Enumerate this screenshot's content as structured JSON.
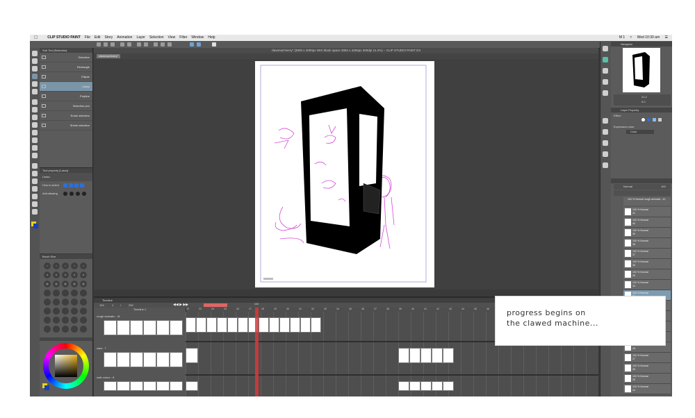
{
  "menubar": {
    "app": "CLIP STUDIO PAINT",
    "items": [
      "File",
      "Edit",
      "Story",
      "Animation",
      "Layer",
      "Selection",
      "View",
      "Filter",
      "Window",
      "Help"
    ],
    "status": "M 1",
    "clock": "Wed 10:30 am"
  },
  "window": {
    "title": "clawmachinery* (3000 x 4000px WHI blank space 3084 x 4284px 300dpi 21.2%) – CLIP STUDIO PAINT EX",
    "tab": "clawmachinery*"
  },
  "subtool": {
    "header": "Sub Tool [Selection]",
    "items": [
      {
        "label": "Selection"
      },
      {
        "label": "Rectangle"
      },
      {
        "label": "Ellipse"
      },
      {
        "label": "Lasso",
        "selected": true
      },
      {
        "label": "Polyline"
      },
      {
        "label": "Selection pen"
      },
      {
        "label": "Erase selection"
      },
      {
        "label": "Shrink selection"
      }
    ]
  },
  "toolprop": {
    "header": "Tool property [Lasso]",
    "tool_name": "Lasso",
    "rows": [
      {
        "label": "How to select"
      },
      {
        "label": "Anti-aliasing"
      }
    ]
  },
  "brush": {
    "header": "Brush Size"
  },
  "timeline": {
    "header": "Timeline",
    "name": "Timeline 1",
    "controls": [
      "102",
      "1",
      "/",
      "232"
    ],
    "frame_numbers": [
      "22",
      "23",
      "24",
      "25",
      "26",
      "27",
      "28",
      "29",
      "30",
      "31",
      "32",
      "33",
      "34",
      "35",
      "36",
      "37",
      "38",
      "39",
      "40",
      "41",
      "42",
      "43",
      "44",
      "45",
      "46",
      "47",
      "48",
      "49",
      "50",
      "51",
      "52",
      "53",
      "54"
    ],
    "current_frame": "103",
    "tracks": [
      {
        "name": "rough animatic : 41"
      },
      {
        "name": "claw : 7"
      },
      {
        "name": "nath colour : 8"
      }
    ]
  },
  "navigator": {
    "header": "Navigator",
    "zoom": "21.2",
    "angle": "0.0"
  },
  "layerprop": {
    "header": "Layer Property",
    "effect": "Effect",
    "expression": "Expression color",
    "expression_value": "Color"
  },
  "layers": {
    "blend": "Normal",
    "opacity": "100",
    "folder": "100 % Normal rough animatic : 41",
    "items": [
      {
        "pct": "100 % Normal",
        "name": "41"
      },
      {
        "pct": "100 % Normal",
        "name": "40"
      },
      {
        "pct": "100 % Normal",
        "name": "39"
      },
      {
        "pct": "100 % Normal",
        "name": "38"
      },
      {
        "pct": "100 % Normal",
        "name": "37"
      },
      {
        "pct": "100 % Normal",
        "name": "36"
      },
      {
        "pct": "100 % Normal",
        "name": "35"
      },
      {
        "pct": "100 % Normal",
        "name": "34"
      },
      {
        "pct": "100 % Normal",
        "name": "33",
        "selected": true
      },
      {
        "pct": "100 % Normal",
        "name": "32"
      },
      {
        "pct": "100 % Normal",
        "name": "31"
      },
      {
        "pct": "100 % Normal",
        "name": "30"
      },
      {
        "pct": "100 % Normal",
        "name": "29"
      },
      {
        "pct": "100 % Normal",
        "name": "28"
      },
      {
        "pct": "100 % Normal",
        "name": "27"
      },
      {
        "pct": "100 % Normal",
        "name": "26"
      },
      {
        "pct": "100 % Normal",
        "name": "25"
      },
      {
        "pct": "100 % Normal",
        "name": "24"
      }
    ]
  },
  "caption": {
    "line1": "progress begins on",
    "line2": "the clawed machine..."
  },
  "colors": {
    "accent_selected": "#7b95a8",
    "playhead": "#d63a3a",
    "sketch": "#d24ad6",
    "background_dark": "#3a3a3a"
  }
}
